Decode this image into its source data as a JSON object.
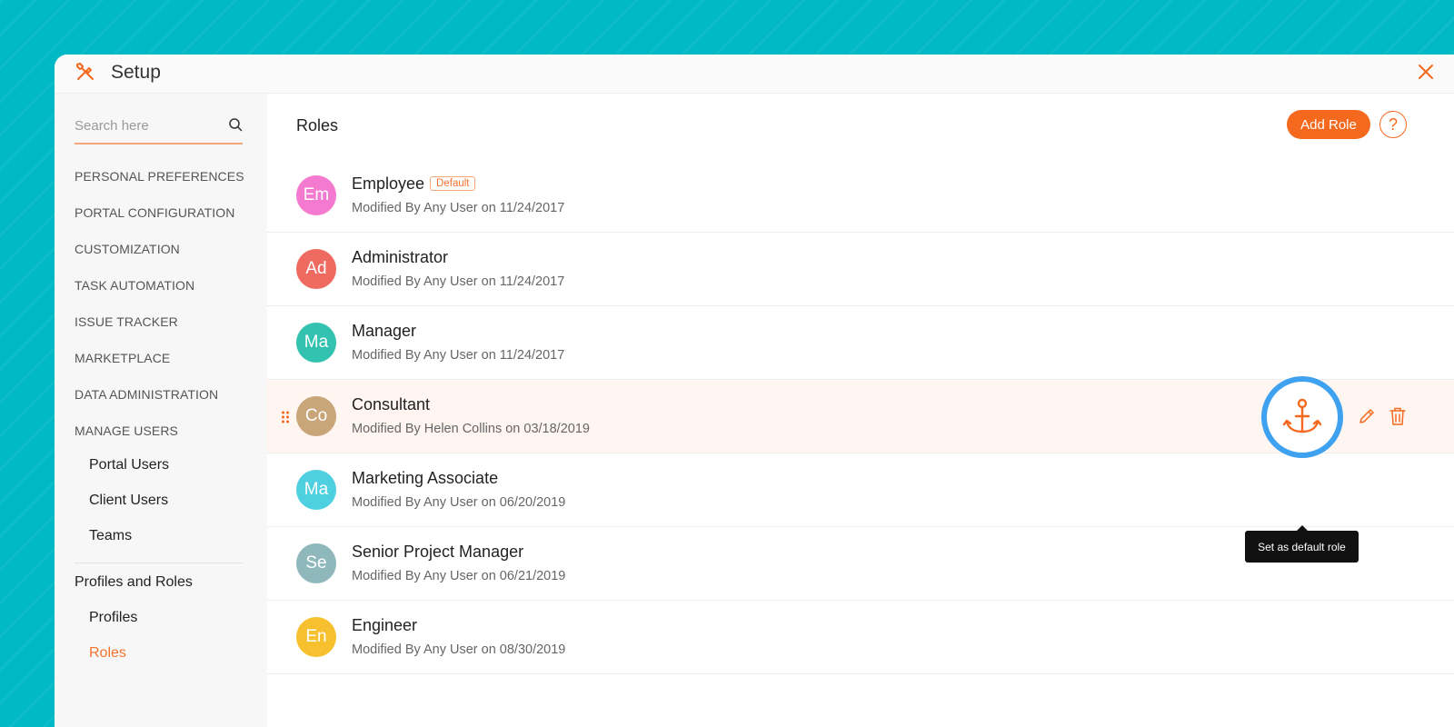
{
  "window": {
    "title": "Setup",
    "title_icon": "tools-icon",
    "close_icon": "close-icon"
  },
  "sidebar": {
    "search_placeholder": "Search here",
    "sections": [
      "PERSONAL PREFERENCES",
      "PORTAL CONFIGURATION",
      "CUSTOMIZATION",
      "TASK AUTOMATION",
      "ISSUE TRACKER",
      "MARKETPLACE",
      "DATA ADMINISTRATION",
      "MANAGE USERS"
    ],
    "manage_users_items": [
      "Portal Users",
      "Client Users",
      "Teams"
    ],
    "profiles_heading": "Profiles and Roles",
    "profiles_items": [
      "Profiles",
      "Roles"
    ],
    "active_item": "Roles"
  },
  "main": {
    "title": "Roles",
    "add_role_label": "Add Role",
    "help_label": "?",
    "roles": [
      {
        "initials": "Em",
        "name": "Employee",
        "badge": "Default",
        "meta": "Modified By Any User on 11/24/2017",
        "color": "#f47ad0"
      },
      {
        "initials": "Ad",
        "name": "Administrator",
        "meta": "Modified By Any User on 11/24/2017",
        "color": "#ef6b62"
      },
      {
        "initials": "Ma",
        "name": "Manager",
        "meta": "Modified By Any User on 11/24/2017",
        "color": "#33c2b0"
      },
      {
        "initials": "Co",
        "name": "Consultant",
        "meta": "Modified By Helen Collins on 03/18/2019",
        "color": "#c9a57a"
      },
      {
        "initials": "Ma",
        "name": "Marketing Associate",
        "meta": "Modified By Any User on 06/20/2019",
        "color": "#4fd0e0"
      },
      {
        "initials": "Se",
        "name": "Senior Project Manager",
        "meta": "Modified By Any User on 06/21/2019",
        "color": "#8fb8bc"
      },
      {
        "initials": "En",
        "name": "Engineer",
        "meta": "Modified By Any User on 08/30/2019",
        "color": "#f7c02f"
      }
    ],
    "tooltip": "Set as default role"
  },
  "colors": {
    "accent": "#f5691e",
    "background": "#00b8c6",
    "anchor_ring": "#3ea2f0"
  }
}
